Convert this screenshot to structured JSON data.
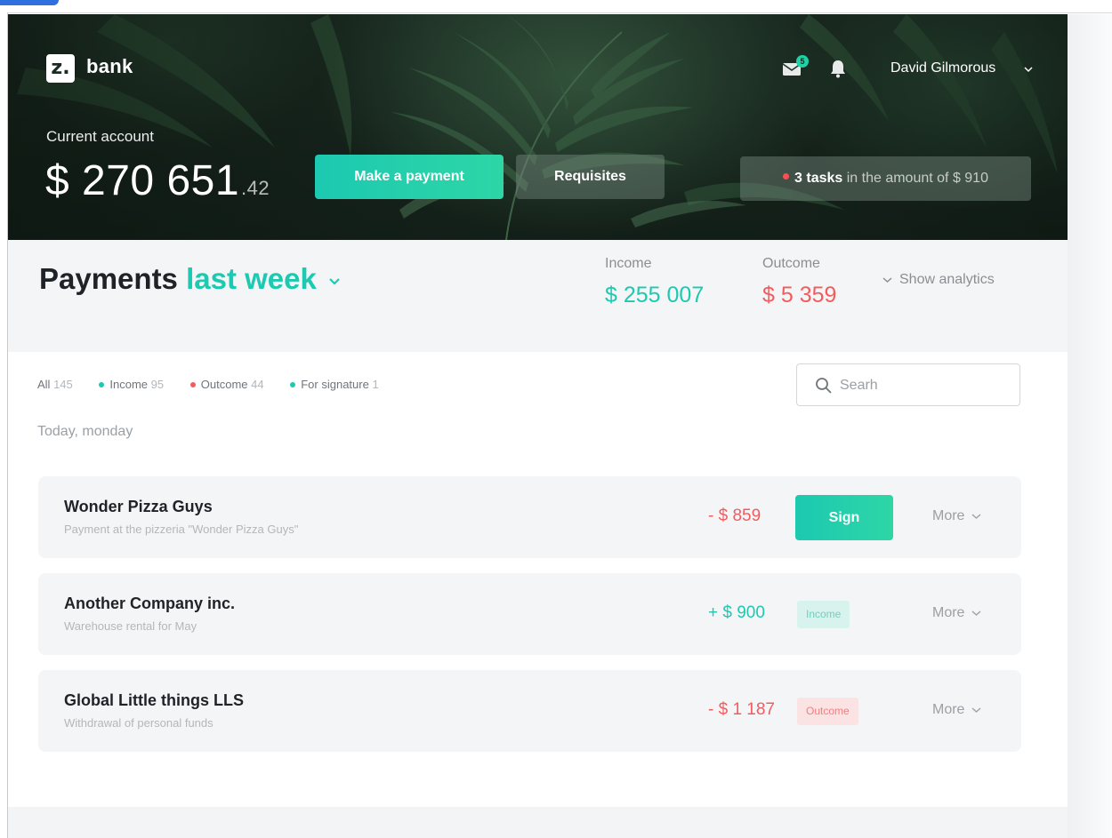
{
  "header": {
    "logo_mark": "z.",
    "logo_text": "bank",
    "mail_badge_count": "5",
    "user_name": "David Gilmorous",
    "account_label": "Current account",
    "balance_main": "$ 270 651",
    "balance_cents": ".42",
    "make_payment_label": "Make a payment",
    "requisites_label": "Requisites",
    "tasks": {
      "count_text": "3 tasks",
      "middle_text": "in the amount of",
      "amount": "$ 910"
    }
  },
  "summary": {
    "title_prefix": "Payments",
    "title_period": "last week",
    "income_label": "Income",
    "income_value": "$ 255 007",
    "outcome_label": "Outcome",
    "outcome_value": "$ 5 359",
    "analytics_label": "Show analytics"
  },
  "filters": [
    {
      "label": "All",
      "count": "145",
      "dot_color": ""
    },
    {
      "label": "Income",
      "count": "95",
      "dot_color": "#1cc9b1"
    },
    {
      "label": "Outcome",
      "count": "44",
      "dot_color": "#f25c5f"
    },
    {
      "label": "For signature",
      "count": "1",
      "dot_color": "#1cc9b1"
    }
  ],
  "search": {
    "placeholder": "Searh",
    "value": ""
  },
  "day_label": "Today, monday",
  "payments": [
    {
      "name": "Wonder Pizza Guys",
      "description": "Payment at the pizzeria \"Wonder Pizza Guys\"",
      "amount": "- $ 859",
      "action_label": "Sign",
      "more_label": "More"
    },
    {
      "name": "Another Company inc.",
      "description": "Warehouse rental for May",
      "amount": "+ $ 900",
      "tag_label": "Income",
      "more_label": "More"
    },
    {
      "name": "Global Little things LLS",
      "description": "Withdrawal of personal funds",
      "amount": "- $ 1 187",
      "tag_label": "Outcome",
      "more_label": "More"
    }
  ],
  "colors": {
    "accent": "#1cc9b1",
    "negative": "#f25c5f",
    "hero_bg": "#1b2b22"
  },
  "icons": {
    "mail": "mail-icon",
    "bell": "bell-icon",
    "search": "search-icon",
    "chevron": "chevron-down-icon"
  }
}
